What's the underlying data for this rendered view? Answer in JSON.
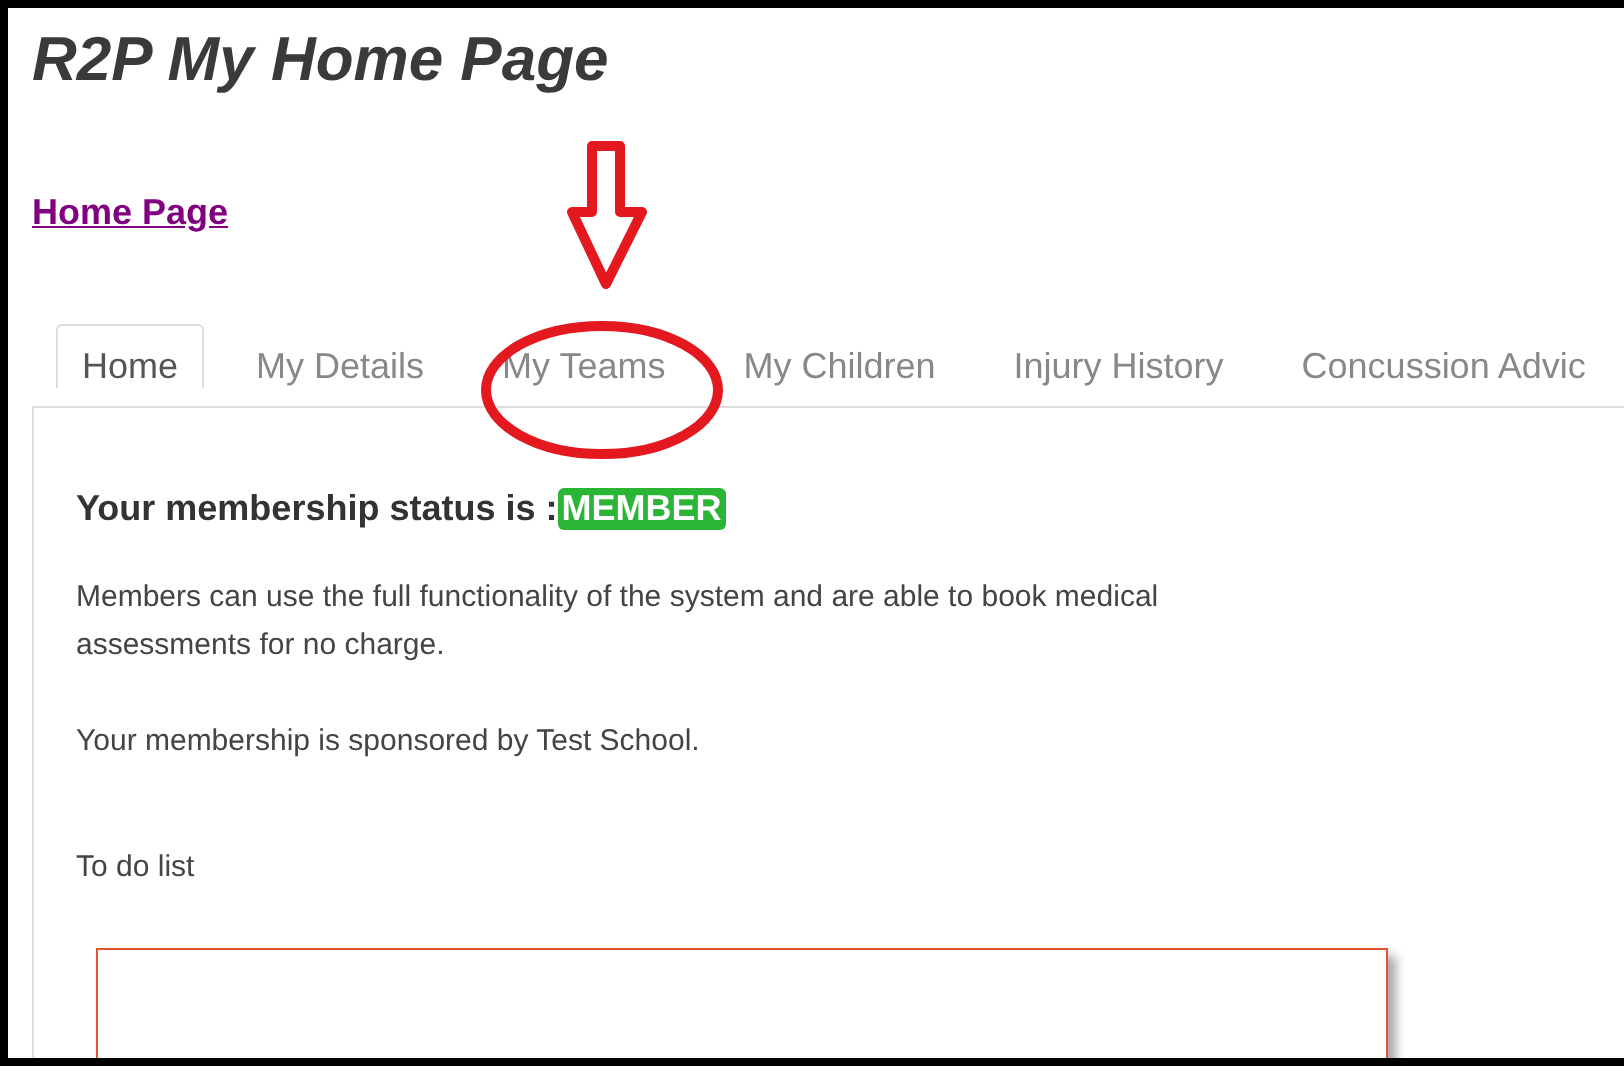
{
  "page": {
    "title": "R2P My Home Page"
  },
  "breadcrumb_link": "Home Page",
  "tabs": [
    {
      "label": "Home",
      "selected": true
    },
    {
      "label": "My Details",
      "selected": false
    },
    {
      "label": "My Teams",
      "selected": false
    },
    {
      "label": "My Children",
      "selected": false
    },
    {
      "label": "Injury History",
      "selected": false
    },
    {
      "label": "Concussion Advic",
      "selected": false
    }
  ],
  "status": {
    "heading": "Your membership status is :",
    "badge": "MEMBER"
  },
  "paragraphs": [
    "Members can use the full functionality of the system and are able to book medical assessments for no charge.",
    "Your membership is sponsored by Test School."
  ],
  "todo_label": "To do list"
}
